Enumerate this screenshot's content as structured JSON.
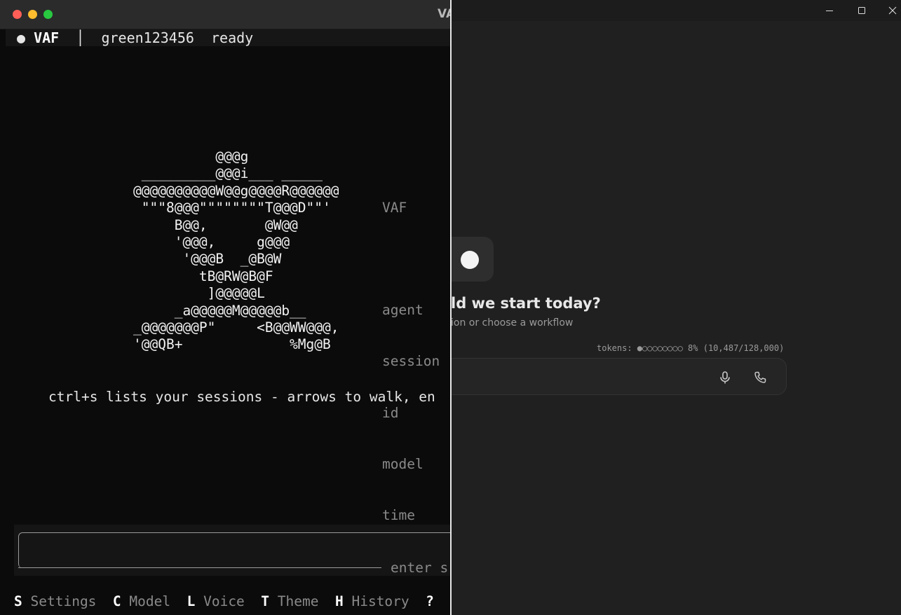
{
  "terminal": {
    "window_title": "VAF",
    "status": {
      "app_name": "VAF",
      "bullet": "●",
      "separator": "│",
      "session_id": "green123456",
      "state": "ready"
    },
    "ascii_logo": "          @@@g\n _________@@@i___ _____\n@@@@@@@@@@W@@g@@@@R@@@@@@\n \"\"\"8@@@\"\"\"\"\"\"\"\"T@@@D\"\"'\n     B@@,       @W@@\n     '@@@,     g@@@\n      '@@@B  _@B@W\n        tB@RW@B@F\n         ]@@@@@L\n     _a@@@@@M@@@@@b__\n_@@@@@@@P\"     <B@@WW@@@,\n'@@QB+             %Mg@B",
    "meta_labels": [
      "VAF",
      "",
      "agent",
      "session",
      "id",
      "model",
      "time"
    ],
    "tip": "ctrl+s lists your sessions - arrows to walk, en",
    "input_hint": "enter s",
    "shortcuts": [
      {
        "key": "S",
        "label": "Settings"
      },
      {
        "key": "C",
        "label": "Model"
      },
      {
        "key": "L",
        "label": "Voice"
      },
      {
        "key": "T",
        "label": "Theme"
      },
      {
        "key": "H",
        "label": "History"
      },
      {
        "key": "?",
        "label": ""
      }
    ]
  },
  "app": {
    "greeting": "ld we start today?",
    "subtext": "ion or choose a workflow",
    "tokens": "tokens: ●○○○○○○○○ 8% (10,487/128,000)",
    "icons": {
      "minimize": "minimize-icon",
      "maximize": "maximize-icon",
      "close": "close-icon",
      "mic": "microphone-icon",
      "call": "phone-icon"
    }
  }
}
